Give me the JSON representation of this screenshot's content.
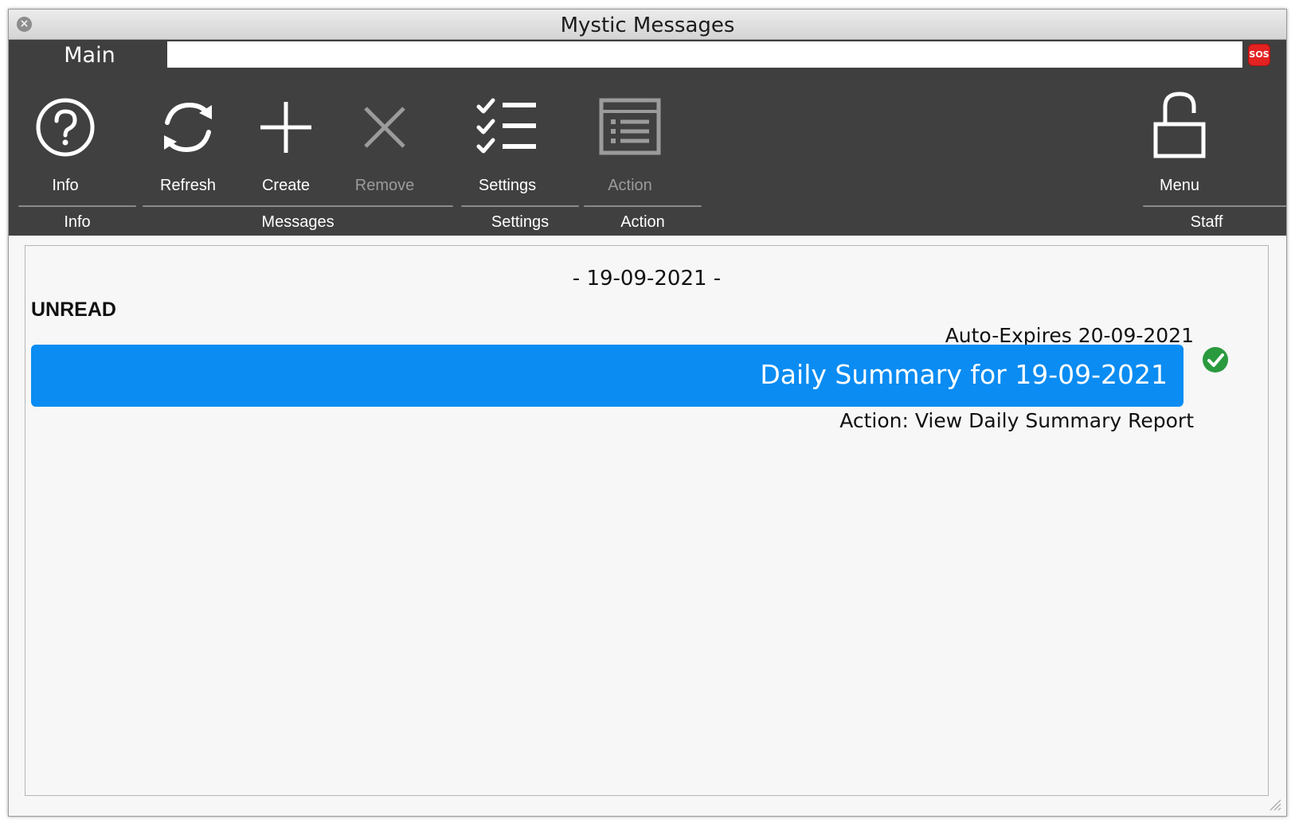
{
  "window": {
    "title": "Mystic Messages"
  },
  "tabs": {
    "main_label": "Main",
    "sos_label": "SOS"
  },
  "toolbar": {
    "tools": [
      {
        "label": "Info",
        "icon": "question-circle-icon",
        "enabled": true
      },
      {
        "label": "Refresh",
        "icon": "refresh-icon",
        "enabled": true
      },
      {
        "label": "Create",
        "icon": "plus-icon",
        "enabled": true
      },
      {
        "label": "Remove",
        "icon": "x-icon",
        "enabled": false
      },
      {
        "label": "Settings",
        "icon": "checklist-icon",
        "enabled": true
      },
      {
        "label": "Action",
        "icon": "list-window-icon",
        "enabled": false
      },
      {
        "label": "Menu",
        "icon": "unlocked-padlock-icon",
        "enabled": true
      }
    ],
    "groups": [
      "Info",
      "Messages",
      "Settings",
      "Action",
      "Staff"
    ]
  },
  "content": {
    "date_header": "- 19-09-2021 -",
    "section_label": "UNREAD",
    "message": {
      "expires": "Auto-Expires 20-09-2021",
      "title": "Daily Summary for 19-09-2021",
      "action": "Action: View Daily Summary Report",
      "status_icon": "green-check-icon"
    }
  },
  "colors": {
    "ribbon_bg": "#404040",
    "message_bar": "#0a8cf2",
    "sos_red": "#e32222",
    "check_green": "#2a9a3f"
  }
}
